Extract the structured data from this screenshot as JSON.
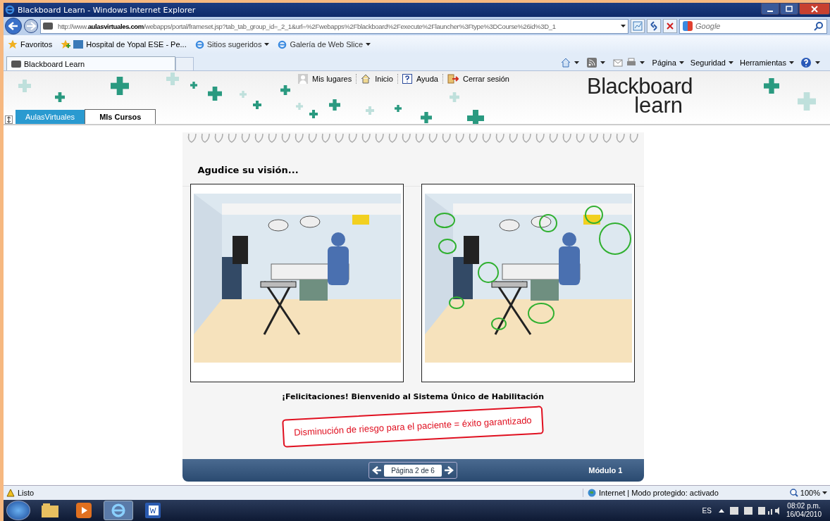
{
  "window": {
    "title": "Blackboard Learn - Windows Internet Explorer"
  },
  "address_bar": {
    "url_prefix": "http://www.",
    "url_domain": "aulasvirtuales.com",
    "url_rest": "/webapps/portal/frameset.jsp?tab_tab_group_id=_2_1&url=%2Fwebapps%2Fblackboard%2Fexecute%2Flauncher%3Ftype%3DCourse%26id%3D_1"
  },
  "search": {
    "placeholder": "Google"
  },
  "favorites_bar": [
    {
      "label": "Favoritos",
      "kind": "favorites"
    },
    {
      "label": "Hospital de Yopal ESE - Pe...",
      "kind": "link"
    },
    {
      "label": "Sitios sugeridos",
      "kind": "menu"
    },
    {
      "label": "Galería de Web Slice",
      "kind": "menu"
    }
  ],
  "browser_tab": {
    "label": "Blackboard Learn"
  },
  "command_bar": [
    "Página",
    "Seguridad",
    "Herramientas"
  ],
  "header_links": [
    {
      "label": "Mis lugares",
      "kind": "person"
    },
    {
      "label": "Inicio",
      "kind": "home"
    },
    {
      "label": "Ayuda",
      "kind": "help"
    },
    {
      "label": "Cerrar sesión",
      "kind": "logout"
    }
  ],
  "course_tabs": [
    {
      "label": "AulasVirtuales",
      "selected": false
    },
    {
      "label": "MIs Cursos",
      "selected": true
    }
  ],
  "logo": {
    "line_1": "Blackboard",
    "line_2": "learn"
  },
  "lesson": {
    "heading": "Agudice su visión...",
    "congratulations": "**¡Felicitaciones!** Bienvenido al Sistema Único de Habilitación",
    "banner": "Disminución de riesgo para el paciente = éxito garantizado",
    "pager": "Página 2 de 6",
    "module": "Módulo 1"
  },
  "status_bar": {
    "status": "Listo",
    "zone": "Internet | Modo protegido: activado",
    "zoom": "100%"
  },
  "taskbar": {
    "language": "ES",
    "time": "08:02 p.m.",
    "date": "16/04/2010"
  }
}
